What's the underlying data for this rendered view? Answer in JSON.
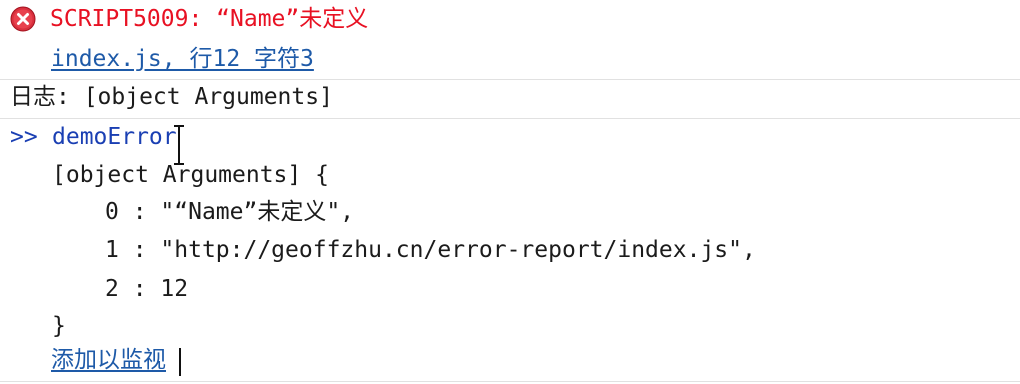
{
  "error": {
    "message": "SCRIPT5009: “Name”未定义",
    "location_link": "index.js, 行12 字符3",
    "icon": "error-icon"
  },
  "log": {
    "text": "日志: [object Arguments]"
  },
  "command": {
    "prompt": ">>",
    "input": "demoError"
  },
  "result": {
    "header": "[object Arguments] {",
    "properties": [
      {
        "key": "0",
        "value": "\"“Name”未定义\","
      },
      {
        "key": "1",
        "value": "\"http://geoffzhu.cn/error-report/index.js\","
      },
      {
        "key": "2",
        "value": "12"
      }
    ],
    "footer": "}",
    "add_watch_link": "添加以监视"
  },
  "colors": {
    "error": "#e81123",
    "link": "#1e5aa8",
    "prompt": "#1a3fb3",
    "divider": "#e1e1e1"
  }
}
